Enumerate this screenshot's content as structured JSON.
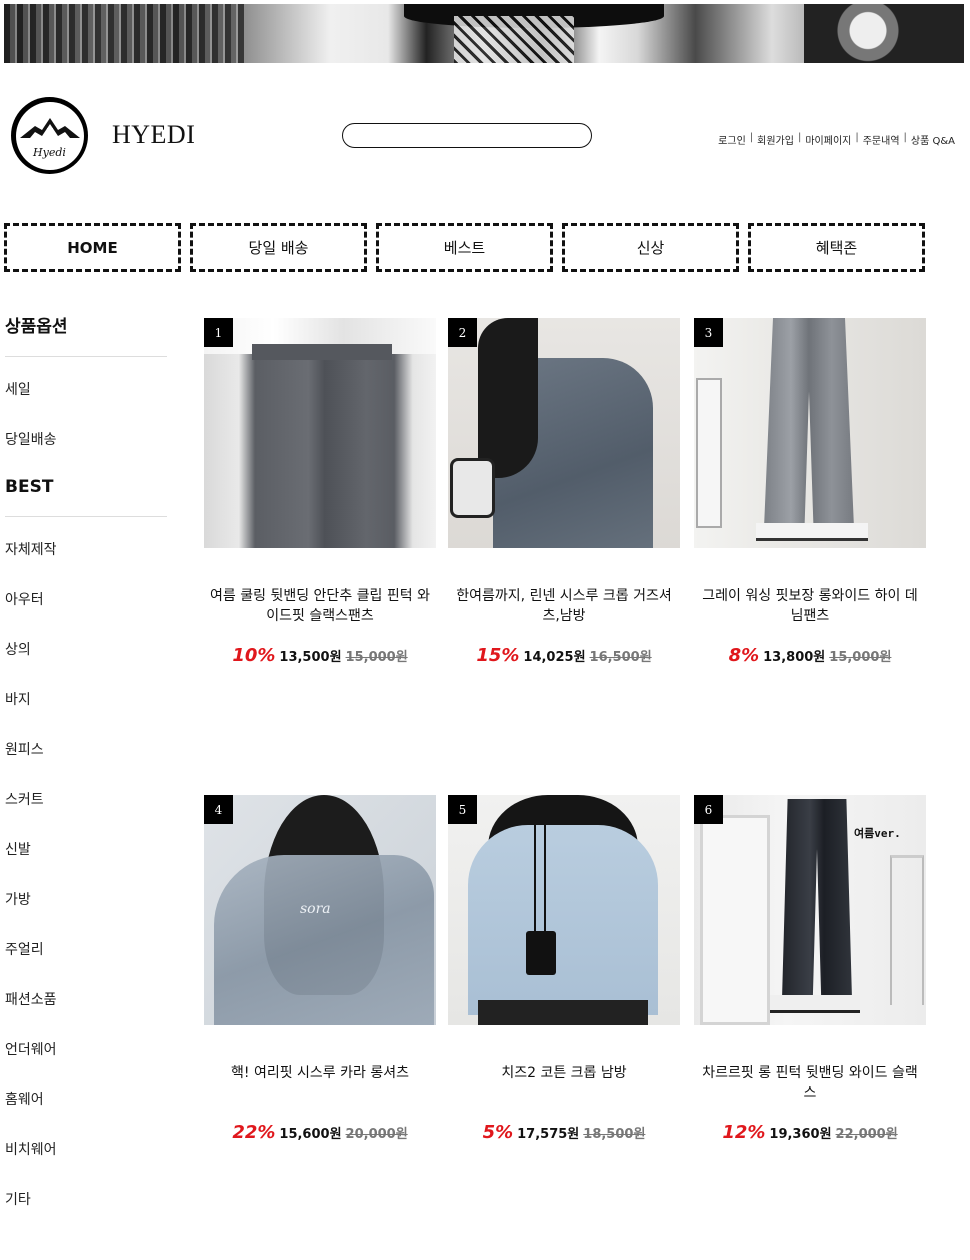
{
  "header": {
    "brand": "HYEDI",
    "logo_text": "Hyedi",
    "search_placeholder": "",
    "links": [
      "로그인",
      "회원가입",
      "마이페이지",
      "주문내역",
      "상품 Q&A"
    ]
  },
  "nav": [
    "HOME",
    "당일 배송",
    "베스트",
    "신상",
    "혜택존"
  ],
  "sidebar": {
    "section1_title": "상품옵션",
    "section1_items": [
      "세일",
      "당일배송"
    ],
    "section2_title": "BEST",
    "section2_items": [
      "자체제작",
      "아우터",
      "상의",
      "바지",
      "원피스",
      "스커트",
      "신발",
      "가방",
      "주얼리",
      "패션소품",
      "언더웨어",
      "홈웨어",
      "비치웨어",
      "기타"
    ]
  },
  "products": [
    {
      "rank": "1",
      "name": "여름 쿨링 뒷밴딩 안단추 클립 핀턱 와이드핏 슬랙스팬츠",
      "rate": "10%",
      "sale": "13,500원",
      "orig": "15,000원"
    },
    {
      "rank": "2",
      "name": "한여름까지, 린넨 시스루 크롭 거즈셔츠,남방",
      "rate": "15%",
      "sale": "14,025원",
      "orig": "16,500원"
    },
    {
      "rank": "3",
      "name": "그레이 워싱 핏보장 롱와이드 하이 데님팬츠",
      "rate": "8%",
      "sale": "13,800원",
      "orig": "15,000원"
    },
    {
      "rank": "4",
      "name": "핵! 여리핏 시스루 카라 롱셔츠",
      "rate": "22%",
      "sale": "15,600원",
      "orig": "20,000원",
      "image_text": "sora"
    },
    {
      "rank": "5",
      "name": "치즈2 코튼 크롭 남방",
      "rate": "5%",
      "sale": "17,575원",
      "orig": "18,500원"
    },
    {
      "rank": "6",
      "name": "차르르핏 롱 핀턱 뒷밴딩 와이드 슬랙스",
      "rate": "12%",
      "sale": "19,360원",
      "orig": "22,000원",
      "image_text": "여름ver."
    }
  ],
  "colors": {
    "discount": "#e0171c",
    "text": "#111111",
    "border": "#111111"
  }
}
